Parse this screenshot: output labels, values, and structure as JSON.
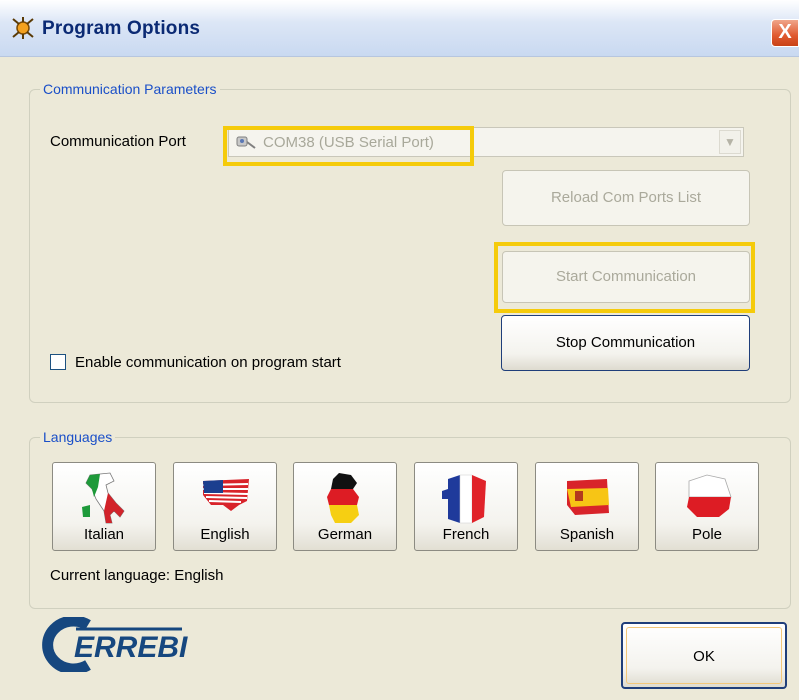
{
  "window": {
    "title": "Program Options",
    "close_label": "X"
  },
  "communication": {
    "group_label": "Communication Parameters",
    "port_label": "Communication Port",
    "port_value": "COM38 (USB Serial Port)",
    "reload_label": "Reload Com Ports List",
    "start_label": "Start Communication",
    "stop_label": "Stop Communication",
    "enable_on_start_label": "Enable communication on program start",
    "enable_on_start_checked": false
  },
  "languages": {
    "group_label": "Languages",
    "items": [
      {
        "label": "Italian",
        "icon": "italy-flag-icon"
      },
      {
        "label": "English",
        "icon": "usa-flag-icon"
      },
      {
        "label": "German",
        "icon": "germany-flag-icon"
      },
      {
        "label": "French",
        "icon": "france-flag-icon"
      },
      {
        "label": "Spanish",
        "icon": "spain-flag-icon"
      },
      {
        "label": "Pole",
        "icon": "poland-flag-icon"
      }
    ],
    "current_label": "Current language: English"
  },
  "logo_text": "CERREBI",
  "ok_label": "OK",
  "colors": {
    "highlight": "#f5cb0b",
    "title_text": "#0b2a74",
    "group_legend": "#1a4fc8",
    "close_button": "#e0592f"
  }
}
